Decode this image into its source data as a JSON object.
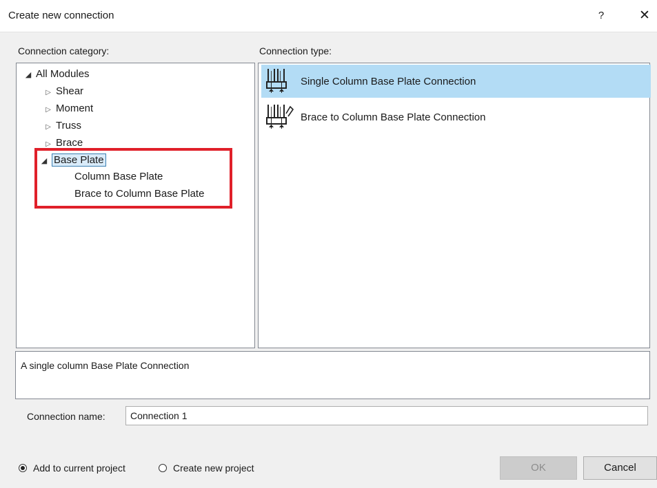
{
  "window": {
    "title": "Create new connection",
    "help_label": "?",
    "close_label": "✕"
  },
  "category": {
    "label": "Connection category:",
    "tree": [
      {
        "label": "All Modules",
        "level": 0,
        "state": "expanded"
      },
      {
        "label": "Shear",
        "level": 1,
        "state": "collapsed"
      },
      {
        "label": "Moment",
        "level": 1,
        "state": "collapsed"
      },
      {
        "label": "Truss",
        "level": 1,
        "state": "collapsed"
      },
      {
        "label": "Brace",
        "level": 1,
        "state": "collapsed"
      },
      {
        "label": "Base Plate",
        "level": 1,
        "state": "expanded",
        "selected": true
      },
      {
        "label": "Column Base Plate",
        "level": 2,
        "state": "leaf"
      },
      {
        "label": "Brace to Column Base Plate",
        "level": 2,
        "state": "leaf"
      }
    ],
    "highlight_color": "#e0202a"
  },
  "types": {
    "label": "Connection type:",
    "items": [
      {
        "label": "Single Column Base Plate Connection",
        "icon": "column-base-plate-icon",
        "selected": true
      },
      {
        "label": "Brace to Column Base Plate Connection",
        "icon": "brace-base-plate-icon",
        "selected": false
      }
    ],
    "selected_color": "#b3dcf5"
  },
  "description": "A single column Base Plate Connection",
  "name": {
    "label": "Connection name:",
    "value": "Connection 1"
  },
  "options": {
    "add_to_current": "Add to current project",
    "create_new": "Create new project",
    "selected": "add_to_current"
  },
  "buttons": {
    "ok": "OK",
    "cancel": "Cancel"
  }
}
